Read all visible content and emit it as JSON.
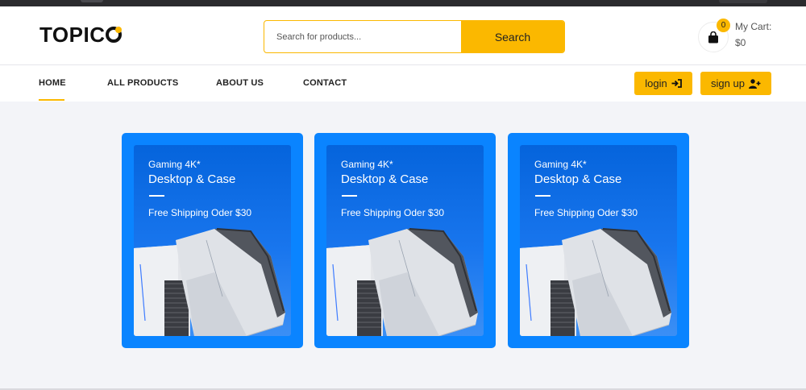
{
  "brand": {
    "logo_text": "TOPIC",
    "accent_color": "#fbb800"
  },
  "search": {
    "placeholder": "Search for products...",
    "button_label": "Search"
  },
  "cart": {
    "count": "0",
    "label": "My Cart:",
    "amount": "$0"
  },
  "nav": {
    "items": [
      {
        "label": "HOME",
        "active": true
      },
      {
        "label": "ALL PRODUCTS",
        "active": false
      },
      {
        "label": "ABOUT US",
        "active": false
      },
      {
        "label": "CONTACT",
        "active": false
      }
    ],
    "login_label": "login",
    "signup_label": "sign up"
  },
  "banners": [
    {
      "line1": "Gaming 4K*",
      "line2": "Desktop & Case",
      "line3": "Free Shipping Oder $30",
      "image": "gaming-pc-case"
    },
    {
      "line1": "Gaming 4K*",
      "line2": "Desktop & Case",
      "line3": "Free Shipping Oder $30",
      "image": "gaming-pc-case"
    },
    {
      "line1": "Gaming 4K*",
      "line2": "Desktop & Case",
      "line3": "Free Shipping Oder $30",
      "image": "gaming-pc-case"
    }
  ],
  "colors": {
    "banner_blue": "#0a84ff",
    "page_bg": "#f3f4f8"
  }
}
